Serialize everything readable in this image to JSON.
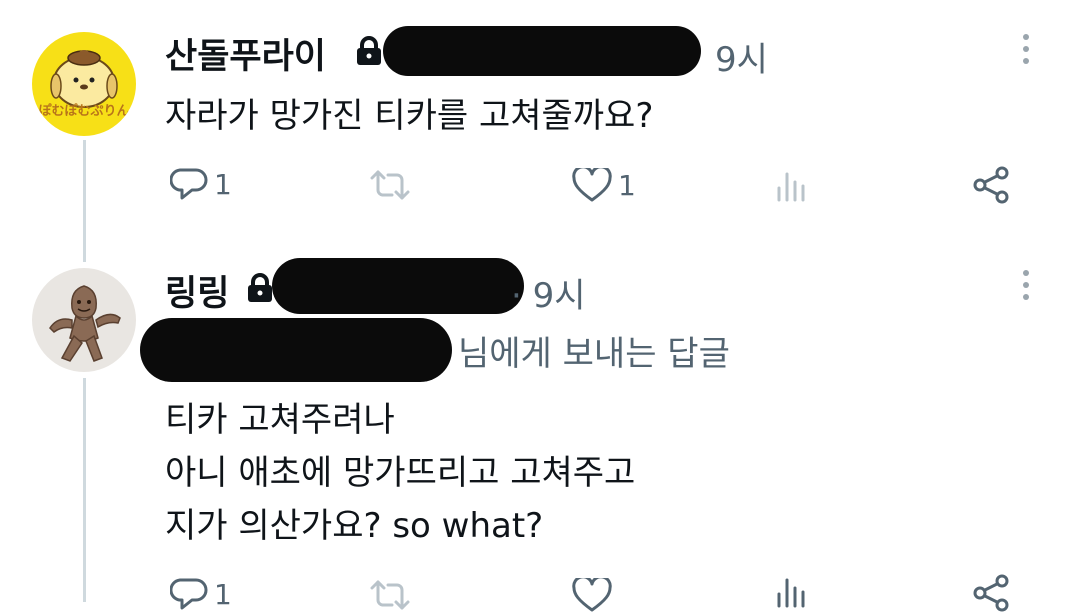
{
  "posts": [
    {
      "author": "산돌푸라이",
      "time": "9시",
      "body": "자라가 망가진 티카를 고쳐줄까요?",
      "avatar_caption": "ぽむぽむぷりん",
      "reply_count": "1",
      "retweet_count": "",
      "like_count": "1"
    },
    {
      "author": "링링",
      "time": "· 9시",
      "replying_to": "님에게 보내는 답글",
      "body_lines": [
        "티카 고쳐주려나",
        "아니 애초에 망가뜨리고 고쳐주고",
        "지가 의산가요? so what?"
      ],
      "reply_count": "1"
    }
  ],
  "colors": {
    "text": "#0f1419",
    "muted": "#536471",
    "thread_line": "#cfd9de",
    "avatar_yellow": "#f7e017"
  },
  "icons": [
    "lock-icon",
    "more-icon",
    "reply-icon",
    "retweet-icon",
    "like-icon",
    "views-icon",
    "share-icon"
  ]
}
